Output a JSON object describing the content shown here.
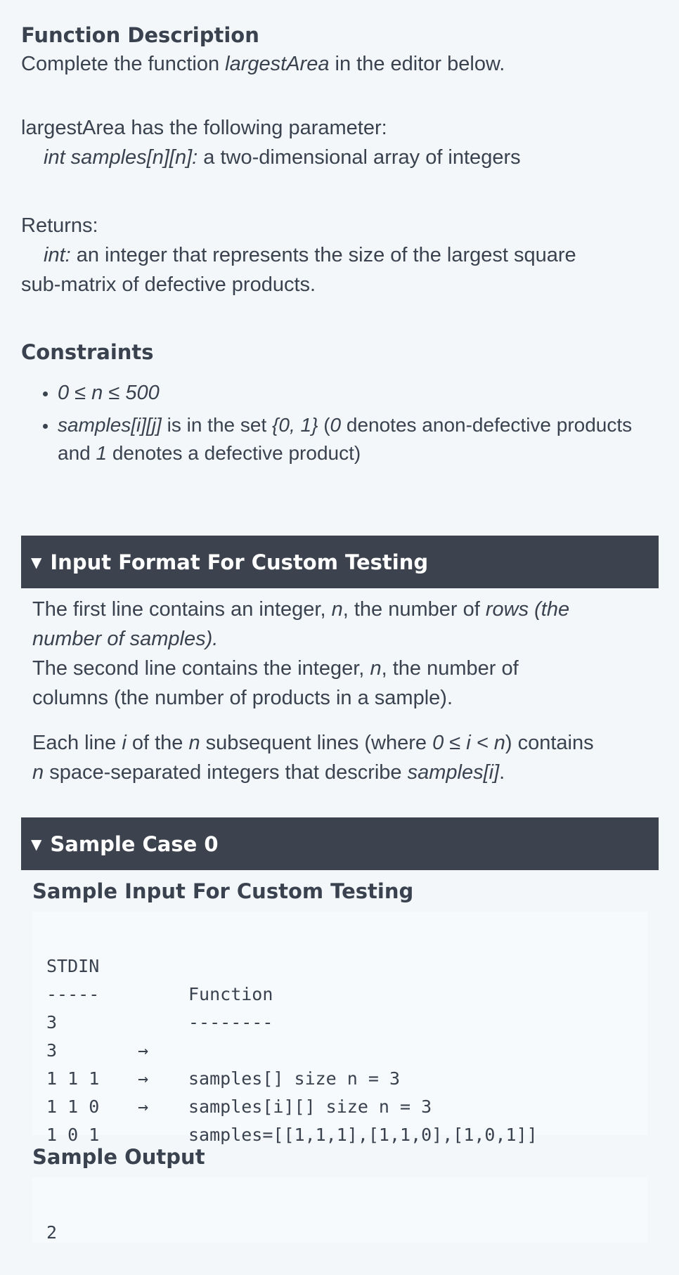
{
  "function_description": {
    "heading": "Function Description",
    "intro_prefix": "Complete the function ",
    "function_name": "largestArea",
    "intro_suffix": " in the editor below.",
    "params_line": "largestArea has the following parameter:",
    "param_name": "int samples[n][n]:",
    "param_desc": "  a two-dimensional array of integers",
    "returns_label": "Returns:",
    "returns_type": "int:",
    "returns_desc_line1": " an integer that represents the size of the largest square",
    "returns_desc_line2": "sub-matrix of defective products."
  },
  "constraints": {
    "heading": "Constraints",
    "item1": "0 ≤ n ≤ 500",
    "item2_var": "samples[i][j]",
    "item2_mid": " is in the set ",
    "item2_set": "{0, 1}",
    "item2_space": " (",
    "item2_zero": "0",
    "item2_zero_desc": " denotes anon-defective products",
    "item2_line2_prefix": "and ",
    "item2_one": "1",
    "item2_one_desc": " denotes a defective product)"
  },
  "input_format": {
    "title": "Input Format For Custom Testing",
    "line1_a": "The first line contains an integer, ",
    "line1_n": "n",
    "line1_b": ", the number of ",
    "line1_rows": "rows (the",
    "line2_italic": "number of samples).",
    "line3_a": "The second line contains the integer, ",
    "line3_n": "n",
    "line3_b": ", the number of",
    "line4": "columns (the number of products in a sample).",
    "line5_a": "Each line ",
    "line5_i": "i",
    "line5_b": " of the ",
    "line5_n": "n",
    "line5_c": " subsequent lines (where ",
    "line5_range": "0 ≤ i < n",
    "line5_d": ") contains",
    "line6_n": "n",
    "line6_a": " space-separated integers that describe ",
    "line6_samples": "samples[i]",
    "line6_end": "."
  },
  "sample_case": {
    "title": "Sample Case 0",
    "input_heading": "Sample Input For Custom Testing",
    "code_header_left": "STDIN",
    "code_header_right": "Function",
    "code_dash_left": "-----",
    "code_dash_right": "--------",
    "rows": [
      {
        "stdin": "3",
        "arrow": "→",
        "func": "samples[] size n = 3"
      },
      {
        "stdin": "3",
        "arrow": "→",
        "func": "samples[i][] size n = 3"
      },
      {
        "stdin": "1 1 1",
        "arrow": "→",
        "func": "samples=[[1,1,1],[1,1,0],[1,0,1]]"
      },
      {
        "stdin": "1 1 0",
        "arrow": "",
        "func": ""
      },
      {
        "stdin": "1 0 1",
        "arrow": "",
        "func": ""
      }
    ],
    "output_heading": "Sample Output",
    "output_value": "2"
  }
}
